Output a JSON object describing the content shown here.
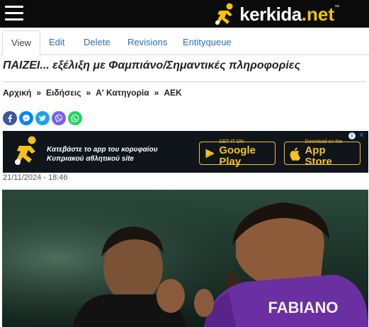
{
  "header": {
    "logo_name": "kerkida",
    "logo_tld": ".net",
    "logo_tm": "™",
    "brand_color": "#f5c400"
  },
  "tabs": [
    {
      "label": "View",
      "active": true
    },
    {
      "label": "Edit",
      "active": false
    },
    {
      "label": "Delete",
      "active": false
    },
    {
      "label": "Revisions",
      "active": false
    },
    {
      "label": "Entityqueue",
      "active": false
    }
  ],
  "article": {
    "title": "ΠΑΙΖΕΙ... εξέλιξη με Φαμπιάνο/Σημαντικές πληροφορίες",
    "date": "21/11/2024 - 18:46"
  },
  "breadcrumb": {
    "items": [
      "Αρχική",
      "Ειδήσεις",
      "Α' Κατηγορία",
      "ΑΕΚ"
    ],
    "separator": "»"
  },
  "share": {
    "icons": [
      "facebook-icon",
      "messenger-icon",
      "twitter-icon",
      "viber-icon",
      "whatsapp-icon"
    ],
    "colors": [
      "#3b5998",
      "#0084ff",
      "#1da1f2",
      "#7360f2",
      "#25d366"
    ]
  },
  "ad": {
    "text_line1": "Κατεβάστε το app του κορυφαίου",
    "text_line2": "Κυπριακού αθλητικού site",
    "google_small": "GET IT ON",
    "google_big": "Google Play",
    "apple_small": "Download on the",
    "apple_big": "App Store",
    "info_icon": "i",
    "close_icon": "✕"
  },
  "photo": {
    "jersey_text": "FABIANO"
  }
}
